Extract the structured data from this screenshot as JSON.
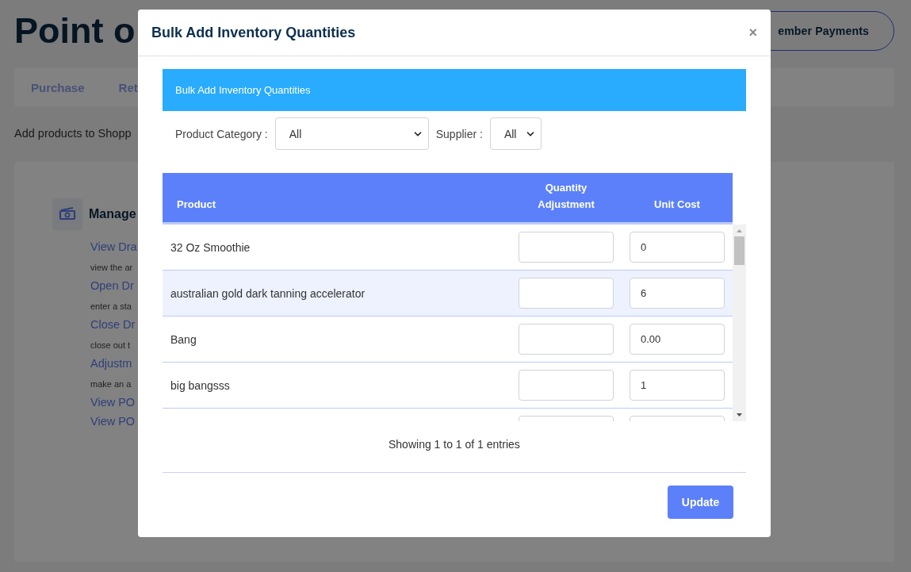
{
  "page": {
    "title": "Point o",
    "header_button": "ember Payments",
    "tabs": [
      {
        "label": "Purchase"
      },
      {
        "label": "Ret"
      }
    ],
    "intro": "Add products to Shopp",
    "card": {
      "title": "Manage",
      "links": [
        {
          "label": "View Dra",
          "description": "view the ar"
        },
        {
          "label": "Open Dr",
          "description": "enter a sta"
        },
        {
          "label": "Close Dr",
          "description": "close out t"
        },
        {
          "label": "Adjustm",
          "description": "make an a"
        },
        {
          "label": "View PO"
        },
        {
          "label": "View PO"
        }
      ]
    }
  },
  "modal": {
    "title": "Bulk Add Inventory Quantities",
    "close": "×",
    "panel_title": "Bulk Add Inventory Quantities",
    "filters": [
      {
        "label": "Product Category :",
        "value": "All"
      },
      {
        "label": "Supplier :",
        "value": "All"
      }
    ],
    "table": {
      "columns": [
        "Product",
        "Quantity Adjustment",
        "Unit Cost"
      ],
      "rows": [
        {
          "product": "32 Oz Smoothie",
          "unit_cost": "0",
          "highlighted": false
        },
        {
          "product": "australian gold dark tanning accelerator",
          "unit_cost": "6",
          "highlighted": true
        },
        {
          "product": "Bang",
          "unit_cost": "0.00",
          "highlighted": false
        },
        {
          "product": "big bangsss",
          "unit_cost": "1",
          "highlighted": false
        },
        {
          "highlighted": false
        }
      ]
    },
    "info": "Showing 1 to 1 of 1 entries",
    "buttons": [
      "Update"
    ]
  }
}
